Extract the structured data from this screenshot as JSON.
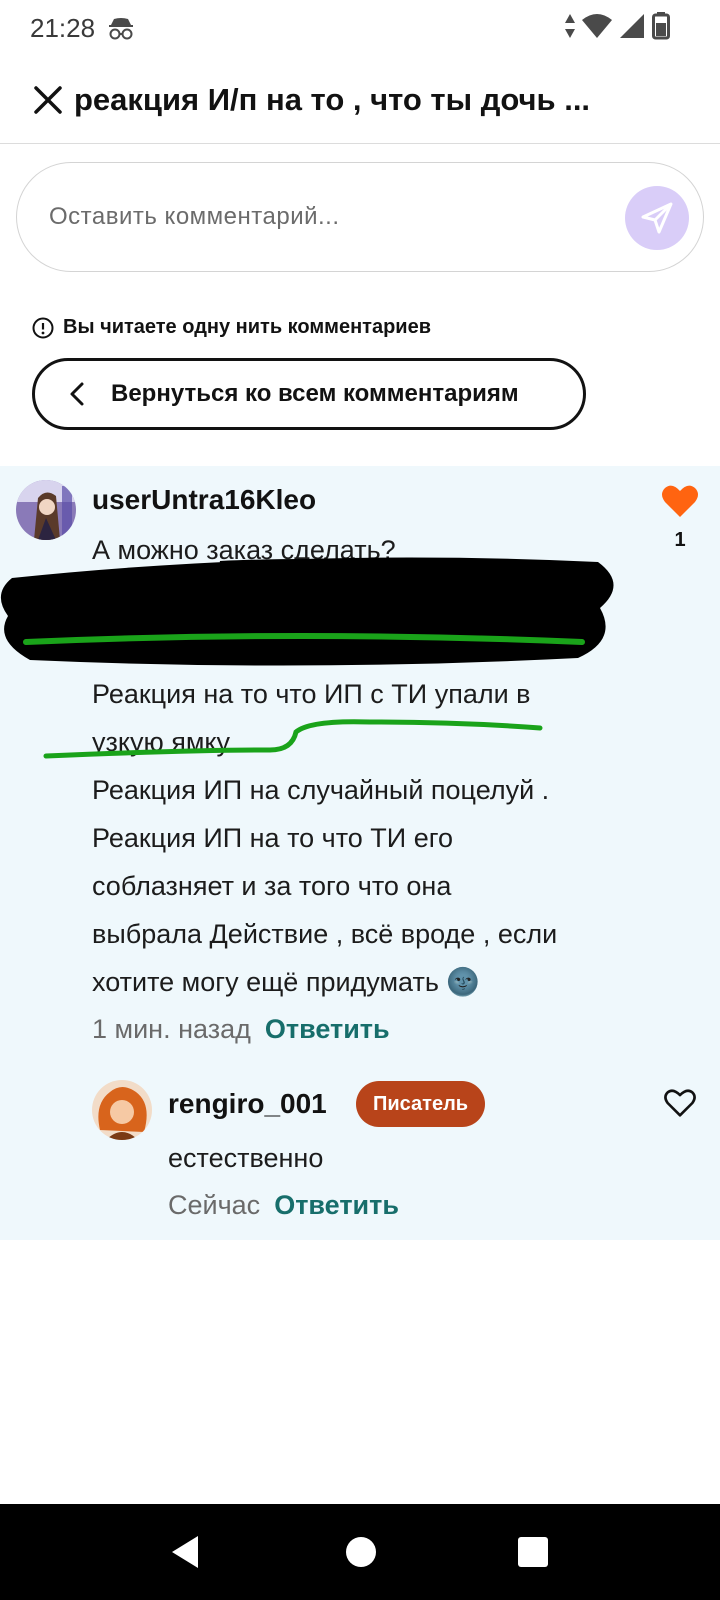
{
  "status_bar": {
    "time": "21:28"
  },
  "header": {
    "title": "реакция И/п на то , что ты дочь ..."
  },
  "comment_box": {
    "placeholder": "Оставить комментарий..."
  },
  "thread_note": "Вы читаете одну нить комментариев",
  "back_button": "Вернуться ко всем комментариям",
  "comment": {
    "username": "userUntra16Kleo",
    "lines": [
      "А можно заказ сделать?",
      "Реакция на то что ИП с ТИ упали в",
      "узкую ямку.",
      "Реакция ИП на случайный поцелуй .",
      "Реакция ИП на то что ТИ его",
      "соблазняет и за того что она",
      "выбрала Действие , всё вроде , если",
      "хотите могу ещё придумать 🌚"
    ],
    "time": "1 мин. назад",
    "reply_label": "Ответить",
    "likes": "1",
    "like_color": "#ff6410"
  },
  "reply": {
    "username": "rengiro_001",
    "badge": "Писатель",
    "badge_color": "#b8441a",
    "text": "естественно",
    "time": "Сейчас",
    "reply_label": "Ответить"
  },
  "colors": {
    "accent_teal": "#176e6b",
    "send_button_bg": "#d9cdf8",
    "thread_bg": "#eff8fc",
    "redaction": "#000000",
    "highlight_stroke": "#1aa31a"
  },
  "icons": {
    "close": "close-icon",
    "send": "send-icon",
    "info": "info-icon",
    "back": "chevron-left-icon",
    "like_filled": "heart-filled-icon",
    "like_outline": "heart-outline-icon"
  }
}
